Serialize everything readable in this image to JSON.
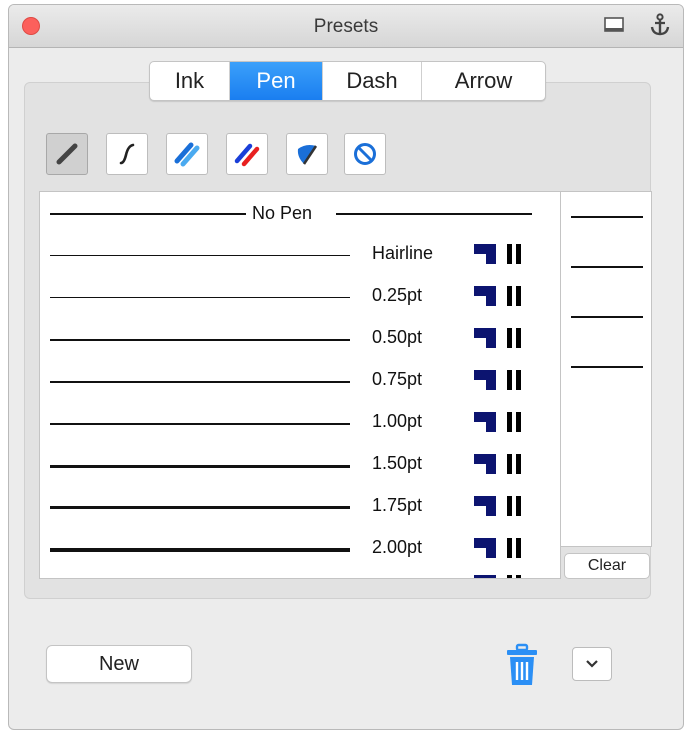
{
  "window": {
    "title": "Presets",
    "title_icons": [
      "panel-icon",
      "anchor-icon"
    ]
  },
  "tabs": [
    {
      "label": "Ink",
      "active": false
    },
    {
      "label": "Pen",
      "active": true
    },
    {
      "label": "Dash",
      "active": false
    },
    {
      "label": "Arrow",
      "active": false
    }
  ],
  "tools": [
    {
      "name": "pen-tool-icon",
      "active": true
    },
    {
      "name": "curve-tool-icon",
      "active": false
    },
    {
      "name": "blue-double-stroke-icon",
      "active": false
    },
    {
      "name": "red-blue-stroke-icon",
      "active": false
    },
    {
      "name": "blue-shape-icon",
      "active": false
    },
    {
      "name": "no-pen-icon",
      "active": false
    }
  ],
  "pen_list": {
    "no_pen_label": "No Pen",
    "items": [
      {
        "label": "Hairline"
      },
      {
        "label": "0.25pt"
      },
      {
        "label": "0.50pt"
      },
      {
        "label": "0.75pt"
      },
      {
        "label": "1.00pt"
      },
      {
        "label": "1.50pt"
      },
      {
        "label": "1.75pt"
      },
      {
        "label": "2.00pt"
      }
    ]
  },
  "side_panel": {
    "clear_label": "Clear"
  },
  "footer": {
    "new_label": "New",
    "trash_icon": "trash-icon",
    "menu_icon": "chevron-down-icon"
  },
  "colors": {
    "accent": "#1a7ef0",
    "close": "#fc605c",
    "swatch_navy": "#0c1470",
    "trash": "#2b8ff5"
  }
}
